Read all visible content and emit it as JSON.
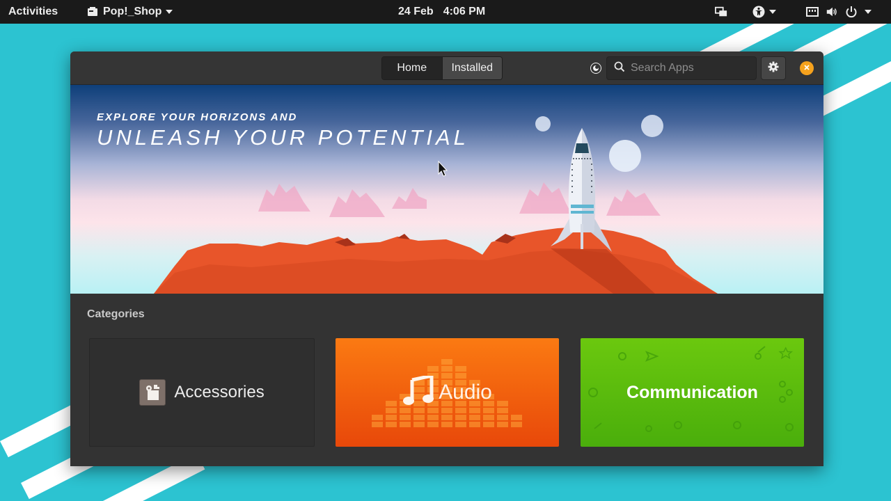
{
  "topbar": {
    "activities": "Activities",
    "app_menu": "Pop!_Shop",
    "date": "24 Feb",
    "time": "4:06 PM"
  },
  "window": {
    "tabs": [
      {
        "label": "Home",
        "active": true
      },
      {
        "label": "Installed",
        "active": false
      }
    ],
    "search": {
      "placeholder": "Search Apps",
      "value": ""
    },
    "close_color": "#f6a21d"
  },
  "banner": {
    "kicker": "EXPLORE YOUR HORIZONS AND",
    "title": "UNLEASH YOUR POTENTIAL"
  },
  "categories": {
    "heading": "Categories",
    "items": [
      {
        "label": "Accessories",
        "icon": "accessories-icon",
        "color": "#2f2f2f"
      },
      {
        "label": "Audio",
        "icon": "music-note-icon",
        "color": "#f2630e"
      },
      {
        "label": "Communication",
        "icon": "none",
        "color": "#5cbc0e"
      }
    ]
  }
}
